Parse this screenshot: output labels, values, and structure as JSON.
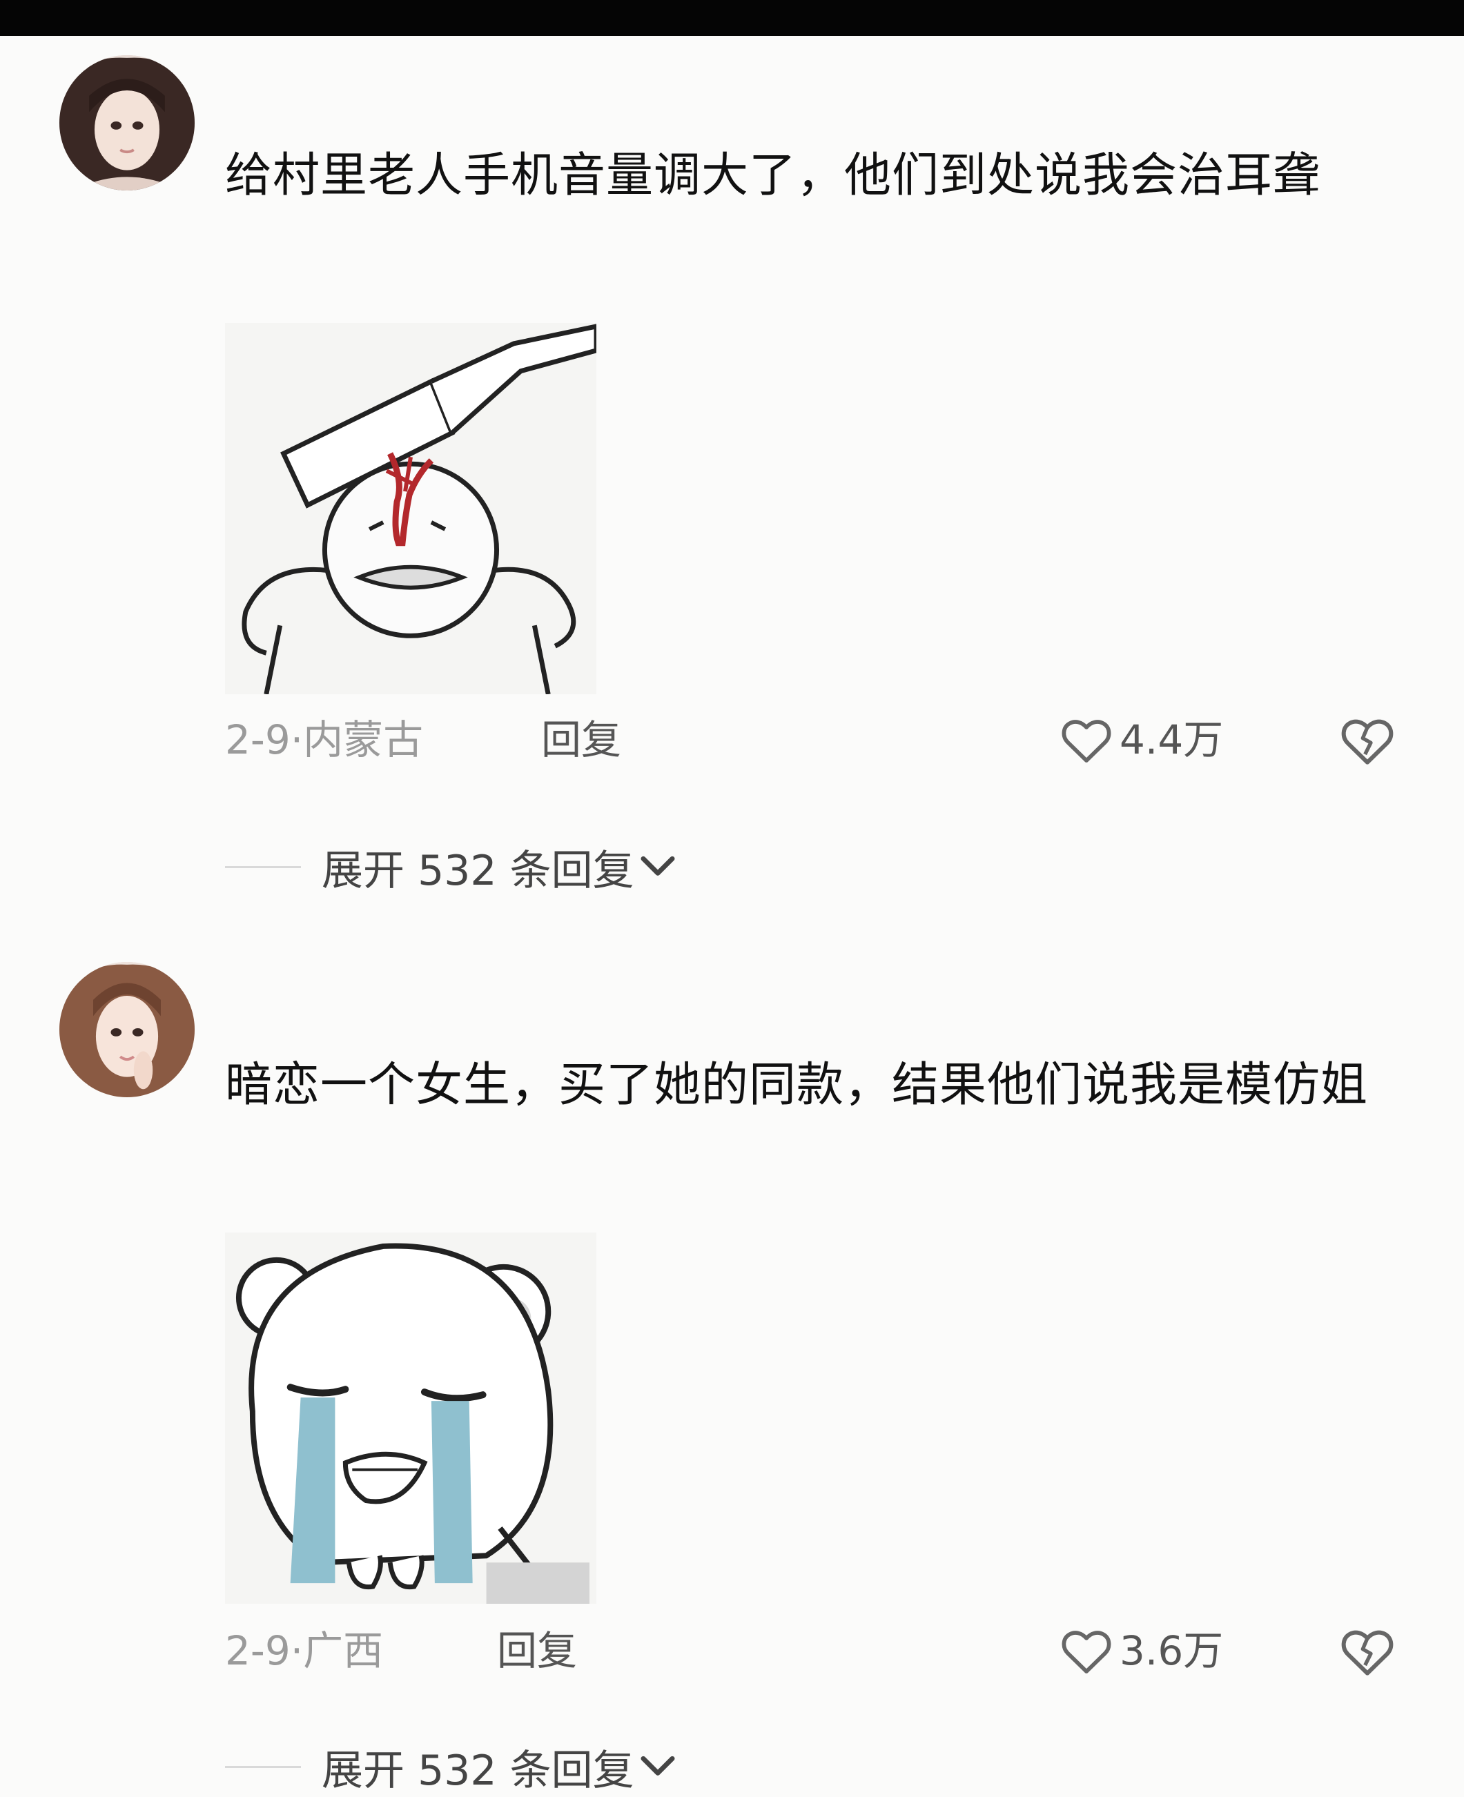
{
  "comments": [
    {
      "text": "给村里老人手机音量调大了，他们到处说我会治耳聋",
      "date": "2-9·内蒙古",
      "reply_label": "回复",
      "likes": "4.4万",
      "expand_label": "展开 532 条回复",
      "avatar_icon": "user-avatar",
      "sticker_icon": "cleaver-head-sticker"
    },
    {
      "text": "暗恋一个女生，买了她的同款，结果他们说我是模仿姐",
      "date": "2-9·广西",
      "reply_label": "回复",
      "likes": "3.6万",
      "expand_label": "展开 532 条回复",
      "avatar_icon": "user-avatar",
      "sticker_icon": "crying-bear-sticker"
    }
  ],
  "icons": {
    "like": "heart-outline-icon",
    "dislike": "broken-heart-icon",
    "expand": "chevron-down-icon"
  },
  "colors": {
    "top_bar": "#050505",
    "background": "#fbfbfa",
    "meta_text": "#9a9a9a",
    "tear_blue": "#8fc0cf"
  }
}
